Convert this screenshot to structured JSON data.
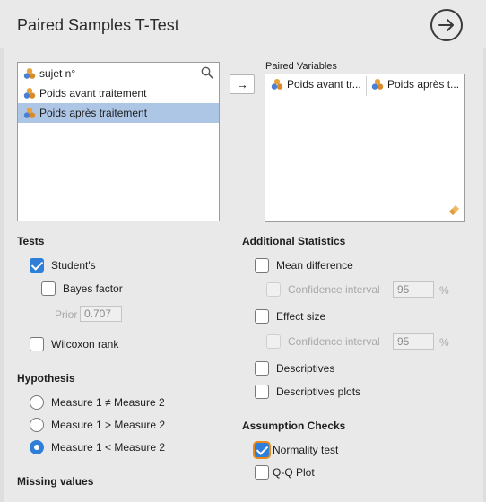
{
  "header": {
    "title": "Paired Samples T-Test",
    "run_icon": "arrow-right-circle-icon"
  },
  "variables": {
    "items": [
      {
        "label": "sujet n°",
        "selected": false
      },
      {
        "label": "Poids avant traitement",
        "selected": false
      },
      {
        "label": "Poids après traitement",
        "selected": true
      }
    ],
    "search_icon": "search-icon",
    "move_label": "→"
  },
  "paired": {
    "label": "Paired Variables",
    "pair": [
      "Poids avant tr...",
      "Poids après t..."
    ],
    "eraser_icon": "eraser-icon"
  },
  "tests": {
    "heading": "Tests",
    "student": "Student's",
    "bayes": "Bayes factor",
    "prior_label": "Prior",
    "prior_value": "0.707",
    "wilcoxon": "Wilcoxon rank"
  },
  "hypothesis": {
    "heading": "Hypothesis",
    "options": [
      "Measure 1 ≠ Measure 2",
      "Measure 1 > Measure 2",
      "Measure 1 < Measure 2"
    ],
    "selected_index": 2
  },
  "missing": {
    "heading": "Missing values"
  },
  "additional": {
    "heading": "Additional Statistics",
    "mean_diff": "Mean difference",
    "ci_label": "Confidence interval",
    "ci_value": "95",
    "percent": "%",
    "effect_size": "Effect size",
    "ci2_label": "Confidence interval",
    "ci2_value": "95",
    "percent2": "%",
    "descriptives": "Descriptives",
    "descriptives_plots": "Descriptives plots"
  },
  "assumptions": {
    "heading": "Assumption Checks",
    "normality": "Normality test",
    "qq": "Q-Q Plot"
  },
  "colors": {
    "accent": "#2f7fd8",
    "selection": "#adc6e6",
    "focus": "#e88a1a"
  }
}
